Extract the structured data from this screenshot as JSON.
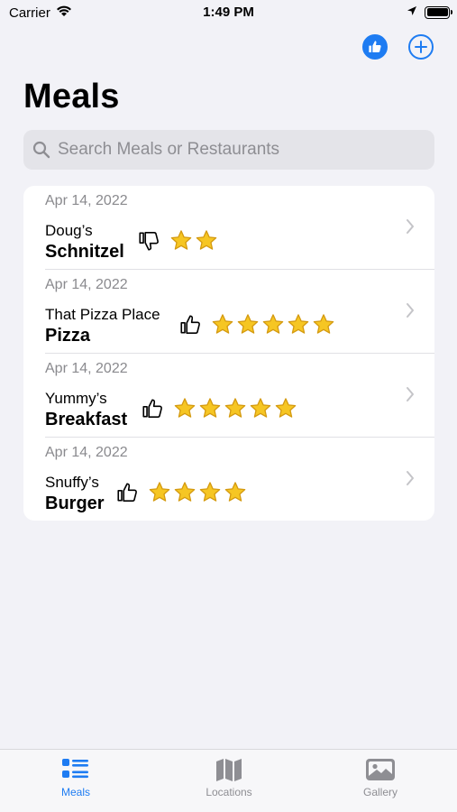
{
  "status_bar": {
    "carrier": "Carrier",
    "time": "1:49 PM"
  },
  "nav": {
    "like_icon": "thumbs-up-circle-icon",
    "add_icon": "plus-circle-icon"
  },
  "page": {
    "title": "Meals"
  },
  "search": {
    "placeholder": "Search Meals or Restaurants",
    "value": ""
  },
  "meals": [
    {
      "date": "Apr 14, 2022",
      "restaurant": "Doug’s",
      "meal": "Schnitzel",
      "thumb": "down",
      "stars": 2
    },
    {
      "date": "Apr 14, 2022",
      "restaurant": "That Pizza Place",
      "meal": "Pizza",
      "thumb": "up",
      "stars": 5
    },
    {
      "date": "Apr 14, 2022",
      "restaurant": "Yummy’s",
      "meal": "Breakfast",
      "thumb": "up",
      "stars": 5
    },
    {
      "date": "Apr 14, 2022",
      "restaurant": "Snuffy’s",
      "meal": "Burger",
      "thumb": "up",
      "stars": 4
    }
  ],
  "tabs": [
    {
      "label": "Meals",
      "icon": "list-icon",
      "active": true
    },
    {
      "label": "Locations",
      "icon": "map-icon",
      "active": false
    },
    {
      "label": "Gallery",
      "icon": "photo-icon",
      "active": false
    }
  ],
  "colors": {
    "accent": "#1e7cf2",
    "background": "#f2f2f7",
    "star": "#f6c623"
  }
}
